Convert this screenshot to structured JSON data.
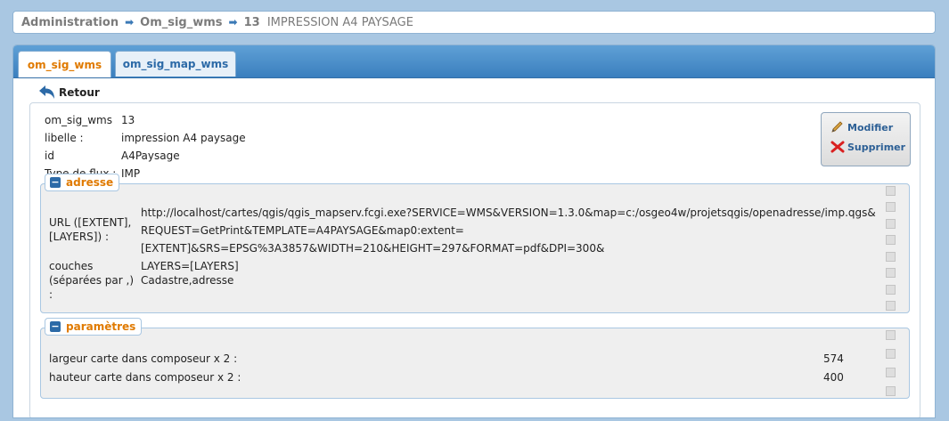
{
  "breadcrumb": {
    "item1": "Administration",
    "item2": "Om_sig_wms",
    "item3_num": "13",
    "item3_text": "IMPRESSION A4 PAYSAGE"
  },
  "tabs": [
    {
      "label": "om_sig_wms",
      "active": true
    },
    {
      "label": "om_sig_map_wms",
      "active": false
    }
  ],
  "retour_label": "Retour",
  "record": {
    "om_sig_wms": {
      "label": "om_sig_wms",
      "value": "13"
    },
    "libelle": {
      "label": "libelle :",
      "value": "impression A4 paysage"
    },
    "id": {
      "label": "id",
      "value": "A4Paysage"
    },
    "type_flux": {
      "label": "Type de flux :",
      "value": "IMP"
    }
  },
  "actions": {
    "modifier": "Modifier",
    "supprimer": "Supprimer"
  },
  "adresse": {
    "legend": "adresse",
    "toggle": "−",
    "url_label_1": "URL ([EXTENT],",
    "url_label_2": "[LAYERS]) :",
    "url_line1": "http://localhost/cartes/qgis/qgis_mapserv.fcgi.exe?SERVICE=WMS&VERSION=1.3.0&map=c:/osgeo4w/projetsqgis/openadresse/imp.qgs&",
    "url_line2": "REQUEST=GetPrint&TEMPLATE=A4PAYSAGE&map0:extent=[EXTENT]&SRS=EPSG%3A3857&WIDTH=210&HEIGHT=297&FORMAT=pdf&DPI=300&",
    "url_line3": "LAYERS=[LAYERS]",
    "couches_label_1": "couches",
    "couches_label_2": "(séparées par ,)",
    "couches_label_3": ":",
    "couches_value": "Cadastre,adresse"
  },
  "parametres": {
    "legend": "paramètres",
    "toggle": "−",
    "rows": [
      {
        "label": "largeur carte dans composeur x 2 :",
        "value": "574"
      },
      {
        "label": "hauteur carte dans composeur x 2 :",
        "value": "400"
      }
    ]
  },
  "colors": {
    "accent_orange": "#e07a00",
    "link_blue": "#2c6aa7",
    "background": "#a9c7e2"
  }
}
